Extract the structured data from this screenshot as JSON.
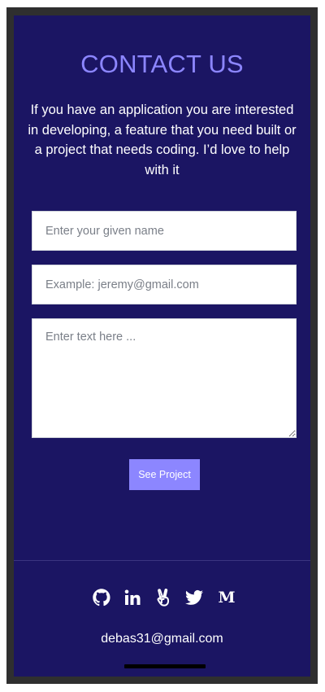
{
  "contact": {
    "title": "CONTACT US",
    "intro": "If you have an application you are interested in developing, a feature that you need built or a project that needs coding. I’d love to help with it",
    "name_placeholder": "Enter your given name",
    "email_placeholder": "Example: jeremy@gmail.com",
    "message_placeholder": "Enter text here ...",
    "submit_label": "See Project"
  },
  "footer": {
    "social_icons": [
      "github-icon",
      "linkedin-icon",
      "angellist-icon",
      "twitter-icon",
      "medium-icon"
    ],
    "medium_glyph": "M",
    "email": "debas31@gmail.com"
  },
  "colors": {
    "background": "#1b1563",
    "accent": "#8c86ff",
    "frame": "#2f2f2f",
    "text": "#ffffff"
  }
}
